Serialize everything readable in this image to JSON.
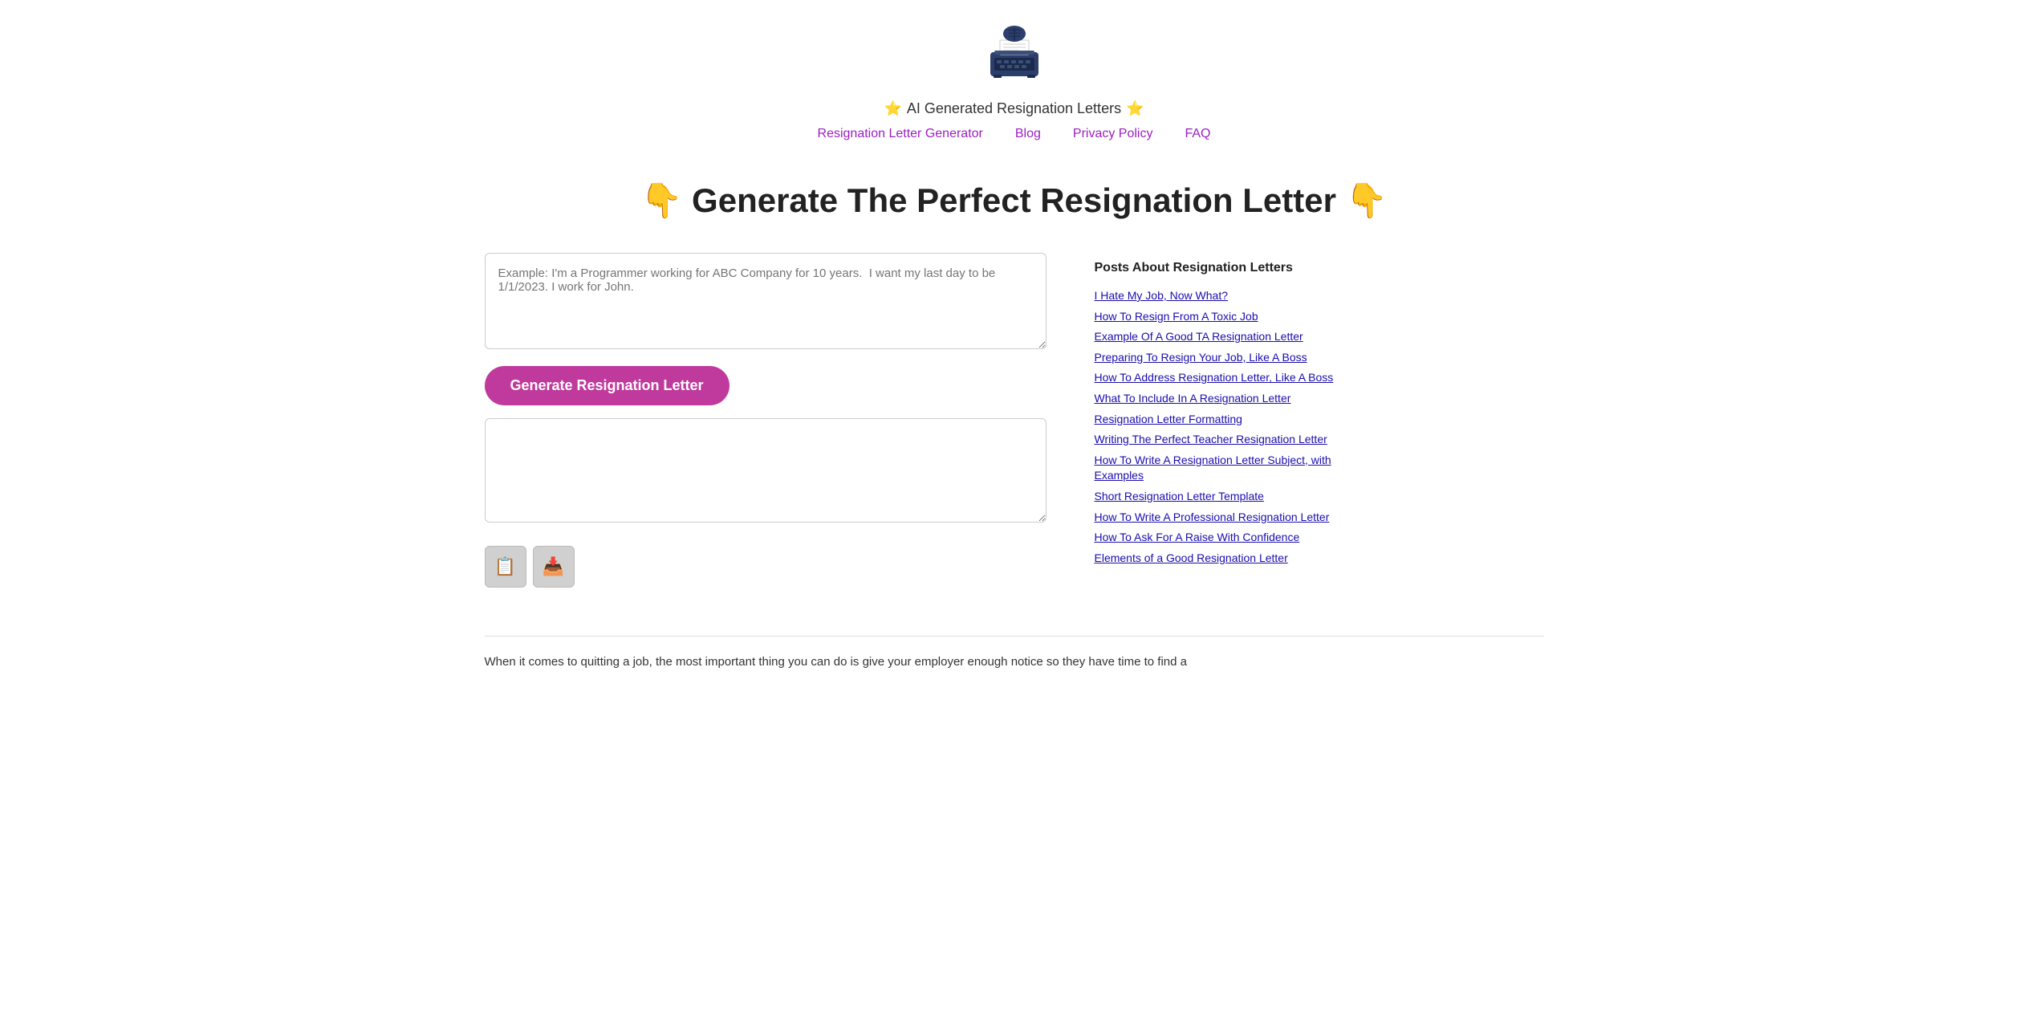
{
  "header": {
    "site_title": "AI Generated Resignation Letters",
    "star_left": "⭐",
    "star_right": "⭐",
    "logo_alt": "AI Typewriter Logo"
  },
  "nav": {
    "items": [
      {
        "label": "Resignation Letter Generator",
        "id": "nav-generator"
      },
      {
        "label": "Blog",
        "id": "nav-blog"
      },
      {
        "label": "Privacy Policy",
        "id": "nav-privacy"
      },
      {
        "label": "FAQ",
        "id": "nav-faq"
      }
    ]
  },
  "hero": {
    "left_icon": "👇",
    "title": "Generate The Perfect Resignation Letter",
    "right_icon": "👇"
  },
  "main": {
    "input_placeholder": "Example: I'm a Programmer working for ABC Company for 10 years.  I want my last day to be 1/1/2023. I work for John.",
    "generate_button_label": "Generate Resignation Letter",
    "output_placeholder": "",
    "copy_icon": "📋",
    "download_icon": "📥"
  },
  "sidebar": {
    "title": "Posts About Resignation Letters",
    "links": [
      {
        "label": "I Hate My Job, Now What?",
        "id": "link-hate-job"
      },
      {
        "label": "How To Resign From A Toxic Job",
        "id": "link-toxic-job"
      },
      {
        "label": "Example Of A Good TA Resignation Letter",
        "id": "link-ta-letter"
      },
      {
        "label": "Preparing To Resign Your Job, Like A Boss",
        "id": "link-prepare-resign"
      },
      {
        "label": "How To Address Resignation Letter, Like A Boss",
        "id": "link-address-letter"
      },
      {
        "label": "What To Include In A Resignation Letter",
        "id": "link-include"
      },
      {
        "label": "Resignation Letter Formatting",
        "id": "link-formatting"
      },
      {
        "label": "Writing The Perfect Teacher Resignation Letter",
        "id": "link-teacher"
      },
      {
        "label": "How To Write A Resignation Letter Subject, with Examples",
        "id": "link-subject"
      },
      {
        "label": "Short Resignation Letter Template",
        "id": "link-short-template"
      },
      {
        "label": "How To Write A Professional Resignation Letter",
        "id": "link-professional"
      },
      {
        "label": "How To Ask For A Raise With Confidence",
        "id": "link-raise"
      },
      {
        "label": "Elements of a Good Resignation Letter",
        "id": "link-elements"
      }
    ]
  },
  "bottom": {
    "text": "When it comes to quitting a job, the most important thing you can do is give your employer enough notice so they have time to find a"
  }
}
